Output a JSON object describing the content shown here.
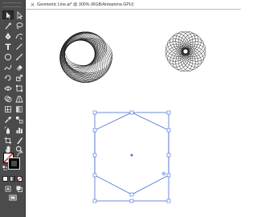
{
  "document_tab": {
    "close_glyph": "×",
    "title": "Geometric Line.ai* @ 300% (RGB/Anteprima GPU)"
  },
  "colors": {
    "toolbar_bg": "#4b4b4b",
    "selection": "#4a6fd9",
    "artwork_stroke": "#1a1a1a",
    "canvas_bg": "#ffffff"
  },
  "toolbar": {
    "tools": [
      {
        "name": "selection-tool",
        "icon": "arrow-black-icon"
      },
      {
        "name": "direct-selection-tool",
        "icon": "arrow-white-icon"
      },
      {
        "name": "magic-wand-tool",
        "icon": "wand-icon"
      },
      {
        "name": "lasso-tool",
        "icon": "lasso-icon"
      },
      {
        "name": "pen-tool",
        "icon": "pen-icon"
      },
      {
        "name": "curvature-tool",
        "icon": "curvature-icon"
      },
      {
        "name": "type-tool",
        "icon": "type-icon"
      },
      {
        "name": "line-segment-tool",
        "icon": "line-icon"
      },
      {
        "name": "ellipse-tool",
        "icon": "ellipse-icon"
      },
      {
        "name": "paintbrush-tool",
        "icon": "brush-icon"
      },
      {
        "name": "shaper-tool",
        "icon": "shaper-icon"
      },
      {
        "name": "eraser-tool",
        "icon": "eraser-icon"
      },
      {
        "name": "rotate-tool",
        "icon": "rotate-icon"
      },
      {
        "name": "scale-tool",
        "icon": "scale-icon"
      },
      {
        "name": "width-tool",
        "icon": "width-icon"
      },
      {
        "name": "free-transform-tool",
        "icon": "free-transform-icon"
      },
      {
        "name": "shape-builder-tool",
        "icon": "shape-builder-icon"
      },
      {
        "name": "perspective-grid-tool",
        "icon": "perspective-icon"
      },
      {
        "name": "mesh-tool",
        "icon": "mesh-icon"
      },
      {
        "name": "gradient-tool",
        "icon": "gradient-icon"
      },
      {
        "name": "eyedropper-tool",
        "icon": "eyedropper-icon"
      },
      {
        "name": "blend-tool",
        "icon": "blend-icon"
      },
      {
        "name": "symbol-sprayer-tool",
        "icon": "spray-icon"
      },
      {
        "name": "column-graph-tool",
        "icon": "graph-icon"
      },
      {
        "name": "artboard-tool",
        "icon": "artboard-icon"
      },
      {
        "name": "slice-tool",
        "icon": "slice-icon"
      },
      {
        "name": "hand-tool",
        "icon": "hand-icon"
      },
      {
        "name": "zoom-tool",
        "icon": "zoom-icon"
      }
    ],
    "swatches": {
      "fill": "none",
      "stroke": "#000000"
    }
  }
}
